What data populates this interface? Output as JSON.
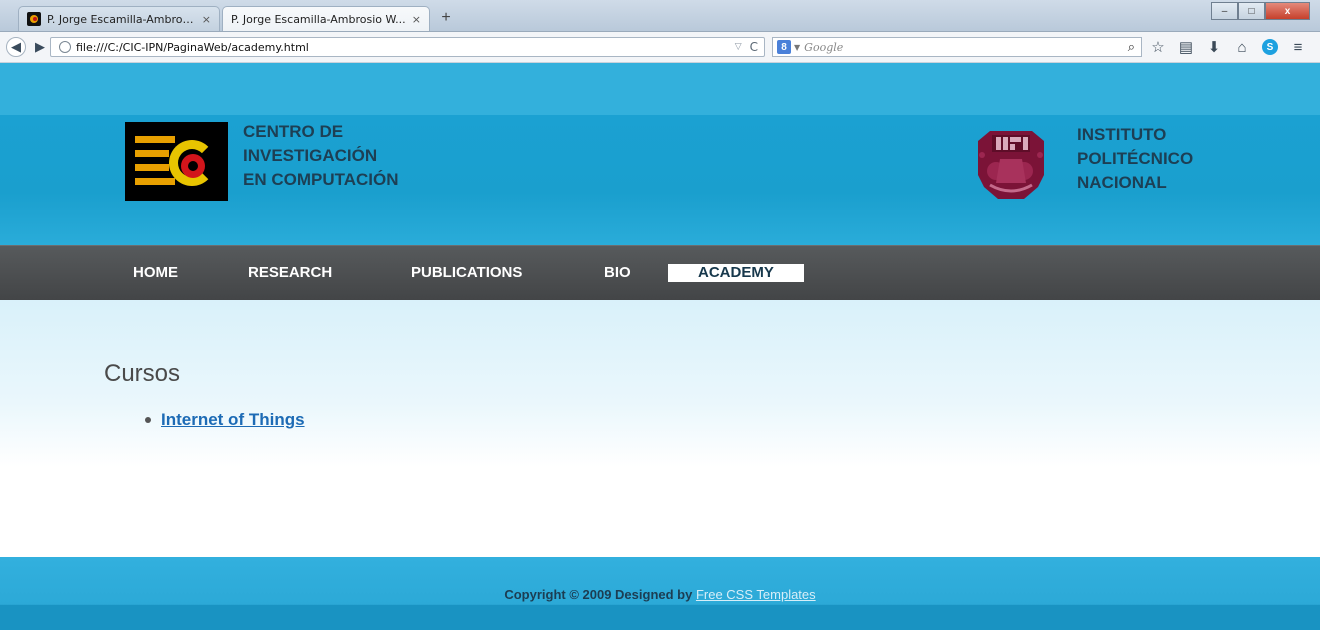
{
  "browser": {
    "tabs": [
      {
        "title": "P. Jorge Escamilla-Ambrosi...",
        "close": "×",
        "active": false
      },
      {
        "title": "P. Jorge Escamilla-Ambrosio W...",
        "close": "×",
        "active": true
      }
    ],
    "new_tab": "+",
    "window_controls": {
      "minimize": "–",
      "maximize": "□",
      "close": "x"
    },
    "url": "file:///C:/CIC-IPN/PaginaWeb/academy.html",
    "search_engine_letter": "8",
    "search_placeholder": "Google",
    "icons": [
      "back-icon",
      "forward-icon",
      "globe-icon",
      "reload-icon",
      "search-icon",
      "bookmark-star-icon",
      "reading-list-icon",
      "download-icon",
      "home-icon",
      "skype-icon",
      "menu-icon"
    ]
  },
  "header": {
    "left_title_lines": [
      "CENTRO DE",
      "INVESTIGACIÓN",
      "EN COMPUTACIÓN"
    ],
    "right_title_lines": [
      "INSTITUTO",
      "POLITÉCNICO",
      "NACIONAL"
    ],
    "logo_left": "cic-logo",
    "logo_right": "ipn-logo"
  },
  "nav": {
    "items": [
      {
        "label": "HOME",
        "active": false
      },
      {
        "label": "RESEARCH",
        "active": false
      },
      {
        "label": "PUBLICATIONS",
        "active": false
      },
      {
        "label": "BIO",
        "active": false
      },
      {
        "label": "ACADEMY",
        "active": true
      }
    ]
  },
  "content": {
    "heading": "Cursos",
    "courses": [
      {
        "label": "Internet of Things"
      }
    ]
  },
  "footer": {
    "copyright_text": "Copyright © 2009 Designed by ",
    "link_text": "Free CSS Templates"
  },
  "colors": {
    "accent": "#33b0dc",
    "header_blue": "#1ba1d2",
    "nav_gray": "#4a4c4e",
    "link_blue": "#1d6bb5",
    "title_navy": "#1d3f54"
  }
}
